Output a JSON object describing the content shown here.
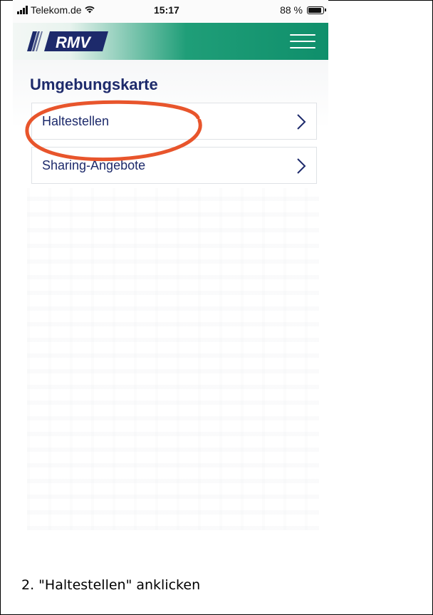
{
  "status_bar": {
    "carrier": "Telekom.de",
    "time": "15:17",
    "battery": "88 %",
    "battery_level": 0.88,
    "icons": [
      "signal-icon",
      "wifi-icon",
      "battery-icon"
    ]
  },
  "header": {
    "logo_text": "RMV",
    "menu_icon": "hamburger-menu-icon",
    "brand_color": "#0f8f6b",
    "logo_color": "#1d2a6b"
  },
  "main": {
    "title": "Umgebungskarte",
    "items": [
      {
        "label": "Haltestellen",
        "icon": "chevron-right-icon"
      },
      {
        "label": "Sharing-Angebote",
        "icon": "chevron-right-icon"
      }
    ]
  },
  "annotation": {
    "color": "#e8552c",
    "target": "Haltestellen"
  },
  "caption": "2. \"Haltestellen\" anklicken"
}
